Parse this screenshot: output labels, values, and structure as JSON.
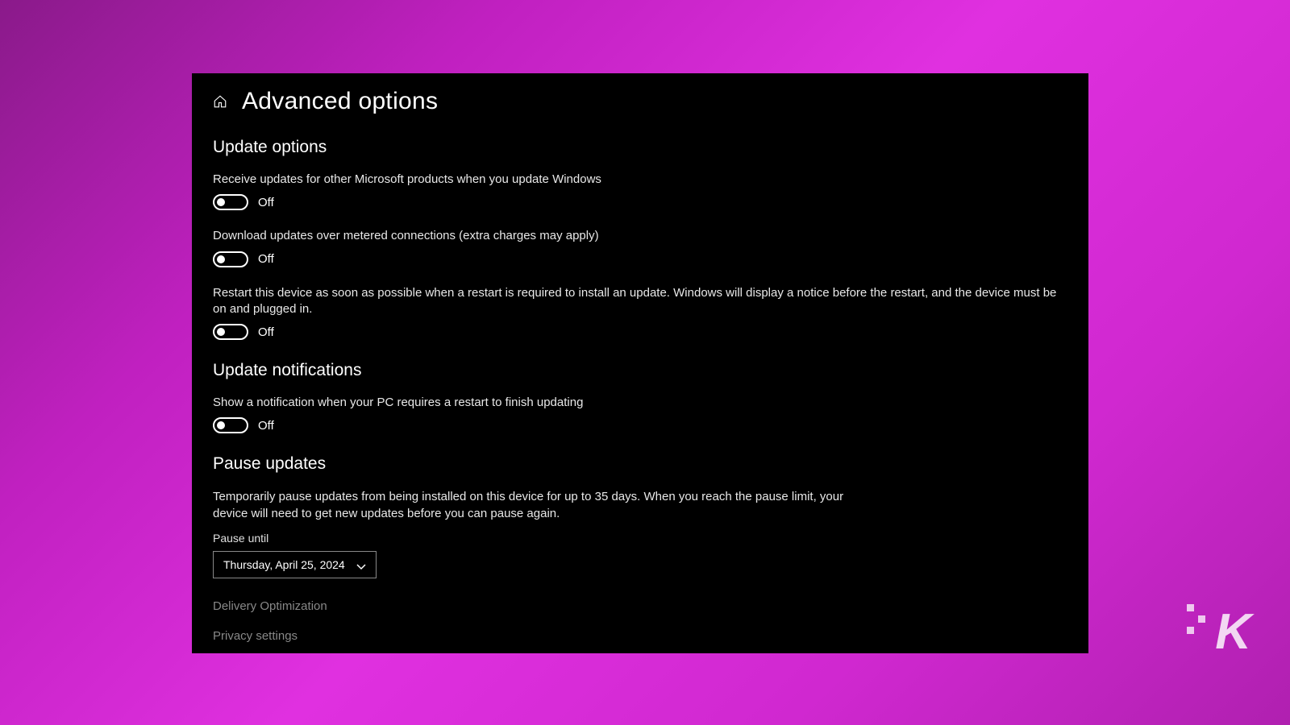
{
  "header": {
    "title": "Advanced options"
  },
  "sections": {
    "update_options": {
      "title": "Update options",
      "items": [
        {
          "label": "Receive updates for other Microsoft products when you update Windows",
          "state": "Off"
        },
        {
          "label": "Download updates over metered connections (extra charges may apply)",
          "state": "Off"
        },
        {
          "label": "Restart this device as soon as possible when a restart is required to install an update. Windows will display a notice before the restart, and the device must be on and plugged in.",
          "state": "Off"
        }
      ]
    },
    "update_notifications": {
      "title": "Update notifications",
      "items": [
        {
          "label": "Show a notification when your PC requires a restart to finish updating",
          "state": "Off"
        }
      ]
    },
    "pause_updates": {
      "title": "Pause updates",
      "description": "Temporarily pause updates from being installed on this device for up to 35 days. When you reach the pause limit, your device will need to get new updates before you can pause again.",
      "pause_until_label": "Pause until",
      "pause_until_value": "Thursday, April 25, 2024"
    }
  },
  "links": {
    "delivery": "Delivery Optimization",
    "privacy": "Privacy settings"
  },
  "watermark": "K"
}
